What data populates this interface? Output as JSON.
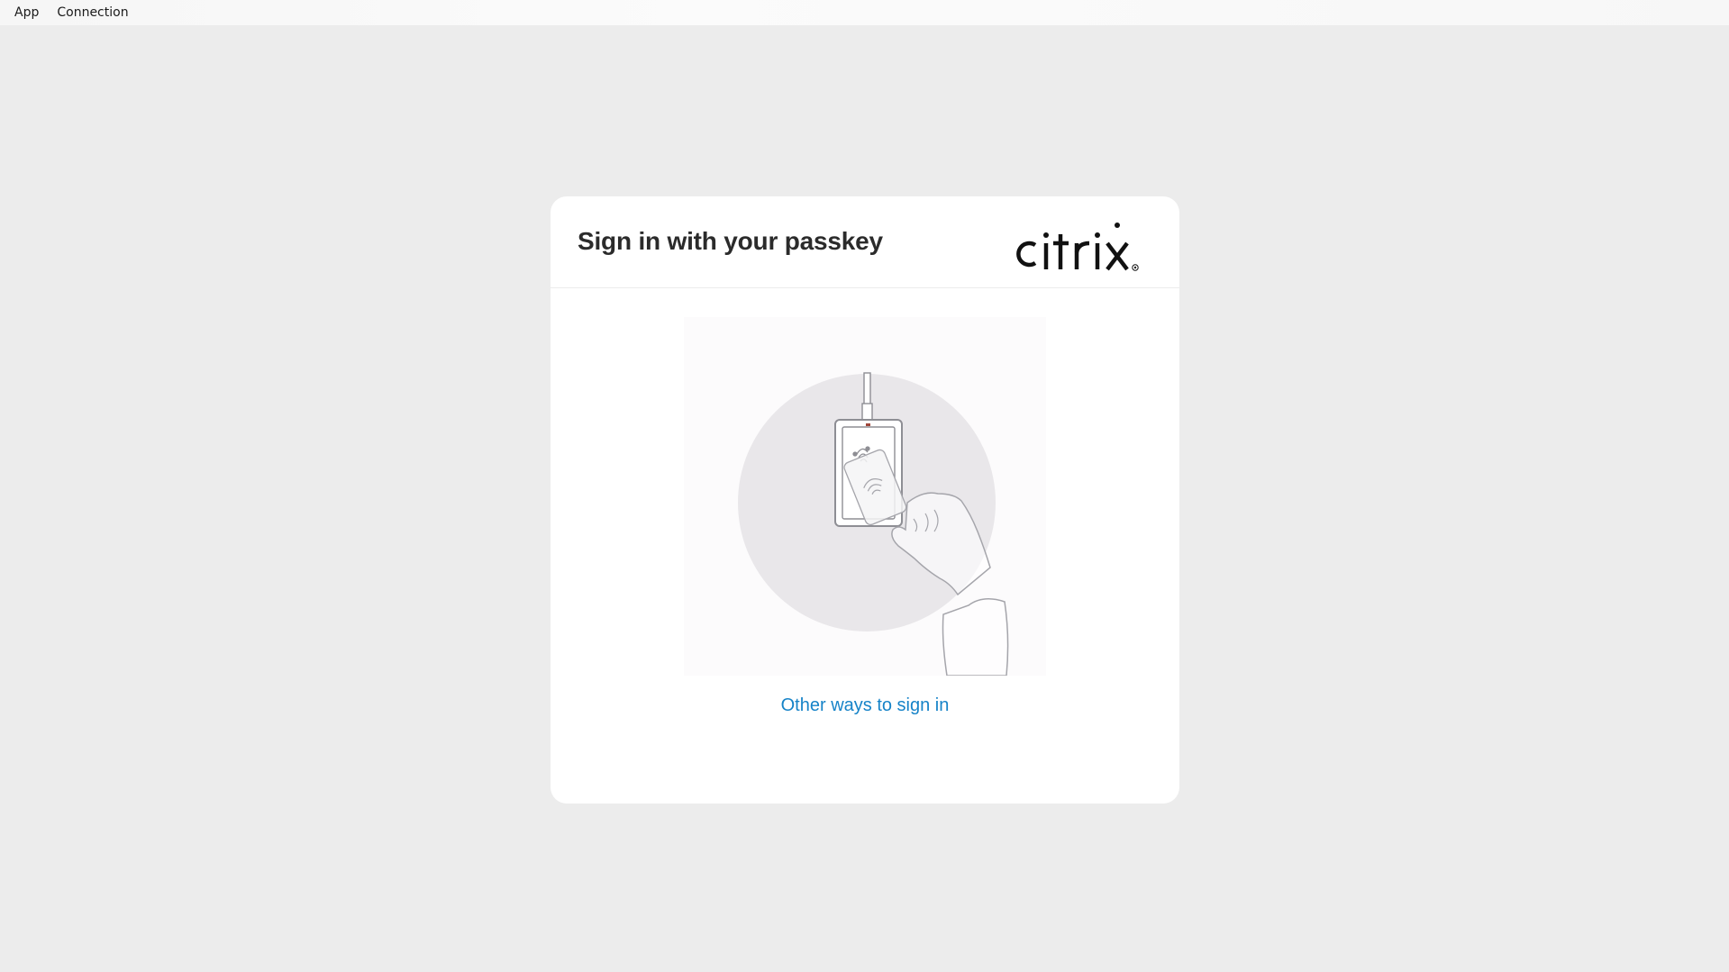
{
  "menubar": {
    "items": [
      {
        "label": "App"
      },
      {
        "label": "Connection"
      }
    ]
  },
  "card": {
    "title": "Sign in with your passkey",
    "logo_text": "citrix",
    "other_ways_link": "Other ways to sign in"
  },
  "colors": {
    "background": "#ececec",
    "card": "#ffffff",
    "link": "#1683c8",
    "title": "#2b2b2b"
  },
  "icons": {
    "illustration": "passkey-security-key-icon"
  }
}
